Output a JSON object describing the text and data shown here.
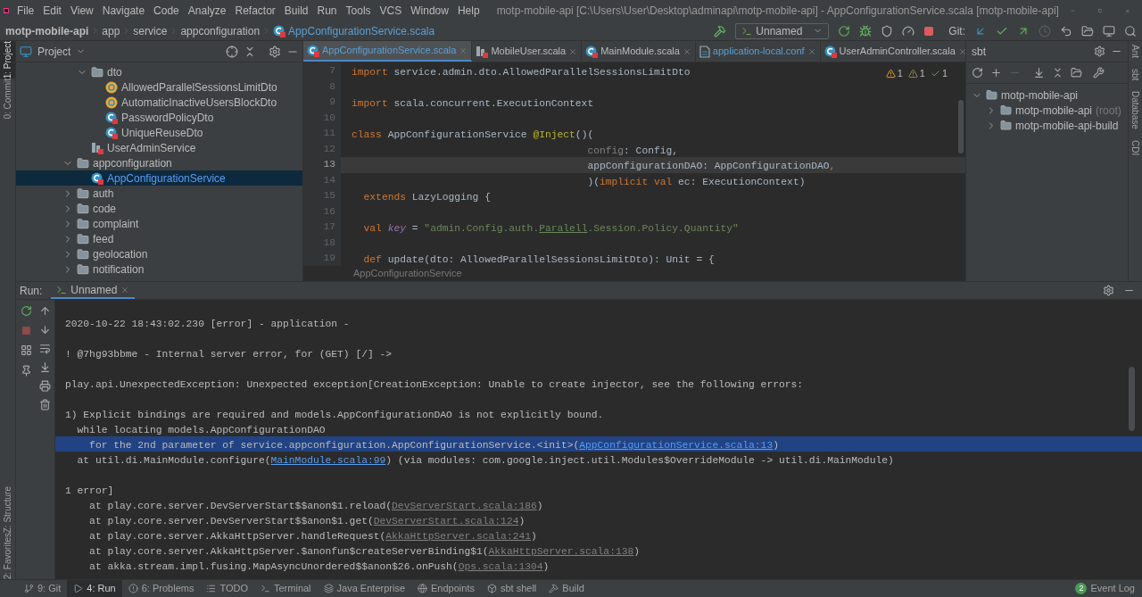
{
  "title_bar": {
    "menu": [
      "File",
      "Edit",
      "View",
      "Navigate",
      "Code",
      "Analyze",
      "Refactor",
      "Build",
      "Run",
      "Tools",
      "VCS",
      "Window",
      "Help"
    ],
    "title": "motp-mobile-api [C:\\Users\\User\\Desktop\\adminapi\\motp-mobile-api] - AppConfigurationService.scala [motp-mobile-api]"
  },
  "nav_bar": {
    "breadcrumbs": [
      {
        "label": "motp-mobile-api",
        "kind": "project"
      },
      {
        "label": "app",
        "kind": "folder"
      },
      {
        "label": "service",
        "kind": "folder"
      },
      {
        "label": "appconfiguration",
        "kind": "folder"
      },
      {
        "label": "AppConfigurationService.scala",
        "kind": "class"
      }
    ],
    "run_config": "Unnamed",
    "git_label": "Git:"
  },
  "left_strip": {
    "top": [
      {
        "label": "1: Project",
        "selected": true
      },
      {
        "label": "0: Commit",
        "selected": false
      }
    ],
    "bottom": [
      {
        "label": "Z: Structure",
        "selected": false
      },
      {
        "label": "2: Favorites",
        "selected": false
      }
    ]
  },
  "project": {
    "title": "Project",
    "partial_branch": [
      {
        "label": "dto",
        "kind": "folder",
        "expanded": true,
        "selected": false,
        "children": [
          {
            "label": "AllowedParallelSessionsLimitDto",
            "kind": "object",
            "selected": false
          },
          {
            "label": "AutomaticInactiveUsersBlockDto",
            "kind": "object",
            "selected": false
          },
          {
            "label": "PasswordPolicyDto",
            "kind": "class",
            "selected": false
          },
          {
            "label": "UniqueReuseDto",
            "kind": "class",
            "selected": false
          }
        ]
      },
      {
        "label": "UserAdminService",
        "kind": "trait",
        "selected": false
      }
    ],
    "tree": [
      {
        "label": "appconfiguration",
        "kind": "folder",
        "expanded": true,
        "selected": false,
        "children": [
          {
            "label": "AppConfigurationService",
            "kind": "class",
            "selected": true
          }
        ]
      },
      {
        "label": "auth",
        "kind": "folder",
        "expanded": false,
        "selected": false
      },
      {
        "label": "code",
        "kind": "folder",
        "expanded": false,
        "selected": false
      },
      {
        "label": "complaint",
        "kind": "folder",
        "expanded": false,
        "selected": false
      },
      {
        "label": "feed",
        "kind": "folder",
        "expanded": false,
        "selected": false
      },
      {
        "label": "geolocation",
        "kind": "folder",
        "expanded": false,
        "selected": false
      },
      {
        "label": "notification",
        "kind": "folder",
        "expanded": false,
        "selected": false
      }
    ]
  },
  "editor": {
    "tabs": [
      {
        "label": "AppConfigurationService.scala",
        "kind": "class",
        "selected": true
      },
      {
        "label": "MobileUser.scala",
        "kind": "trait",
        "selected": false
      },
      {
        "label": "MainModule.scala",
        "kind": "class",
        "selected": false
      },
      {
        "label": "application-local.conf",
        "kind": "conf",
        "selected": false
      },
      {
        "label": "UserAdminController.scala",
        "kind": "class",
        "selected": false
      }
    ],
    "inspections": [
      {
        "count": "1",
        "kind": "warning"
      },
      {
        "count": "1",
        "kind": "weak_warning"
      },
      {
        "count": "1",
        "kind": "typo"
      }
    ],
    "lines": [
      {
        "number": "7",
        "current": false,
        "kind": "top",
        "tokens": [
          {
            "text": "import",
            "kind": "keyword"
          },
          {
            "text": " service.admin.dto.AllowedParallelSessionsLimitDto",
            "kind": "plain"
          }
        ]
      },
      {
        "number": "8",
        "current": false
      },
      {
        "number": "9",
        "current": false,
        "kind": "top",
        "tokens": [
          {
            "text": "import",
            "kind": "keyword"
          },
          {
            "text": " scala.concurrent.ExecutionContext",
            "kind": "plain"
          }
        ]
      },
      {
        "number": "10",
        "current": false
      },
      {
        "number": "11",
        "current": false,
        "kind": "top",
        "tokens": [
          {
            "text": "class",
            "kind": "keyword"
          },
          {
            "text": " AppConfigurationService ",
            "kind": "plain"
          },
          {
            "text": "@Inject",
            "kind": "annotation"
          },
          {
            "text": "()(",
            "kind": "plain"
          }
        ]
      },
      {
        "number": "12",
        "current": false,
        "kind": "param",
        "tokens": [
          {
            "text": "config",
            "kind": "unused"
          },
          {
            "text": ": Config,",
            "kind": "plain"
          }
        ]
      },
      {
        "number": "13",
        "current": true,
        "kind": "param",
        "tokens": [
          {
            "text": "appConfigurationDAO: AppConfigurationDAO",
            "kind": "plain"
          },
          {
            "text": ",",
            "kind": "keyword"
          }
        ]
      },
      {
        "number": "14",
        "current": false,
        "kind": "param",
        "tokens": [
          {
            "text": ")(",
            "kind": "plain"
          },
          {
            "text": "implicit val",
            "kind": "keyword"
          },
          {
            "text": " ec: ExecutionContext)",
            "kind": "plain"
          }
        ]
      },
      {
        "number": "15",
        "current": false,
        "kind": "member",
        "tokens": [
          {
            "text": "extends",
            "kind": "keyword"
          },
          {
            "text": " LazyLogging {",
            "kind": "plain"
          }
        ]
      },
      {
        "number": "16",
        "current": false
      },
      {
        "number": "17",
        "current": false,
        "kind": "member",
        "tokens": [
          {
            "text": "val",
            "kind": "keyword"
          },
          {
            "text": " key",
            "kind": "field"
          },
          {
            "text": " = ",
            "kind": "plain"
          },
          {
            "text": "\"admin.Config.auth.",
            "kind": "string"
          },
          {
            "text": "Paralell",
            "kind": "typo"
          },
          {
            "text": ".Session.Policy.Quantity\"",
            "kind": "string"
          }
        ]
      },
      {
        "number": "18",
        "current": false
      },
      {
        "number": "19",
        "current": false,
        "kind": "member",
        "tokens": [
          {
            "text": "def",
            "kind": "keyword"
          },
          {
            "text": " update(dto: AllowedParallelSessionsLimitDto): Unit = {",
            "kind": "plain"
          }
        ]
      }
    ],
    "breadcrumb": "AppConfigurationService"
  },
  "sbt": {
    "title": "sbt",
    "tree": [
      {
        "label": "motp-mobile-api",
        "expanded": true,
        "children": [
          {
            "label": "motp-mobile-api",
            "note": "(root)",
            "expanded": false
          },
          {
            "label": "motp-mobile-api-build",
            "expanded": false
          }
        ]
      }
    ]
  },
  "right_strip": [
    {
      "label": "Ant"
    },
    {
      "label": "sbt"
    },
    {
      "label": "Database"
    },
    {
      "label": "CDI"
    }
  ],
  "run": {
    "label": "Run:",
    "tabs": [
      {
        "label": "Unnamed",
        "selected": true
      }
    ],
    "lines": [
      {
        "selected": false,
        "kind": "top_gap",
        "segments": [
          {
            "text": "2020-10-22 18:43:02.230 [error] - application -",
            "kind": "text"
          }
        ]
      },
      {
        "selected": false,
        "kind": "top_gap",
        "segments": [
          {
            "text": "! @7hg93bbme - Internal server error, for (GET) [/] ->",
            "kind": "text"
          }
        ]
      },
      {
        "selected": false,
        "kind": "top_gap",
        "segments": [
          {
            "text": "play.api.UnexpectedException: Unexpected exception[CreationException: Unable to create injector, see the following errors:",
            "kind": "text"
          }
        ]
      },
      {
        "selected": false,
        "kind": "top_gap",
        "segments": [
          {
            "text": "1) Explicit bindings are required and models.AppConfigurationDAO is not explicitly bound.",
            "kind": "text"
          }
        ]
      },
      {
        "selected": false,
        "kind": "step",
        "segments": [
          {
            "text": "while locating models.AppConfigurationDAO",
            "kind": "text"
          }
        ]
      },
      {
        "selected": true,
        "kind": "frame",
        "segments": [
          {
            "text": "for the 2nd parameter of service.appconfiguration.AppConfigurationService.<init>(",
            "kind": "text"
          },
          {
            "text": "AppConfigurationService.scala:13",
            "kind": "link"
          },
          {
            "text": ")",
            "kind": "text"
          }
        ]
      },
      {
        "selected": false,
        "kind": "step",
        "segments": [
          {
            "text": "at util.di.MainModule.configure(",
            "kind": "text"
          },
          {
            "text": "MainModule.scala:99",
            "kind": "link"
          },
          {
            "text": ") (via modules: com.google.inject.util.Modules$OverrideModule -> util.di.MainModule)",
            "kind": "text"
          }
        ]
      },
      {
        "selected": false,
        "kind": "top_gap",
        "segments": [
          {
            "text": "1 error]",
            "kind": "text"
          }
        ]
      },
      {
        "selected": false,
        "kind": "frame",
        "segments": [
          {
            "text": "at play.core.server.DevServerStart$$anon$1.reload(",
            "kind": "text"
          },
          {
            "text": "DevServerStart.scala:186",
            "kind": "library_link"
          },
          {
            "text": ")",
            "kind": "text"
          }
        ]
      },
      {
        "selected": false,
        "kind": "frame",
        "segments": [
          {
            "text": "at play.core.server.DevServerStart$$anon$1.get(",
            "kind": "text"
          },
          {
            "text": "DevServerStart.scala:124",
            "kind": "library_link"
          },
          {
            "text": ")",
            "kind": "text"
          }
        ]
      },
      {
        "selected": false,
        "kind": "frame",
        "segments": [
          {
            "text": "at play.core.server.AkkaHttpServer.handleRequest(",
            "kind": "text"
          },
          {
            "text": "AkkaHttpServer.scala:241",
            "kind": "library_link"
          },
          {
            "text": ")",
            "kind": "text"
          }
        ]
      },
      {
        "selected": false,
        "kind": "frame",
        "segments": [
          {
            "text": "at play.core.server.AkkaHttpServer.$anonfun$createServerBinding$1(",
            "kind": "text"
          },
          {
            "text": "AkkaHttpServer.scala:138",
            "kind": "library_link"
          },
          {
            "text": ")",
            "kind": "text"
          }
        ]
      },
      {
        "selected": false,
        "kind": "frame",
        "segments": [
          {
            "text": "at akka.stream.impl.fusing.MapAsyncUnordered$$anon$26.onPush(",
            "kind": "text"
          },
          {
            "text": "Ops.scala:1304",
            "kind": "library_link"
          },
          {
            "text": ")",
            "kind": "text"
          }
        ]
      }
    ]
  },
  "bottom_bar": {
    "tools": [
      {
        "label": "9: Git",
        "kind": "git",
        "selected": false
      },
      {
        "label": "4: Run",
        "kind": "run",
        "selected": true
      },
      {
        "label": "6: Problems",
        "kind": "problems",
        "selected": false
      },
      {
        "label": "TODO",
        "kind": "todo",
        "selected": false
      },
      {
        "label": "Terminal",
        "kind": "terminal",
        "selected": false
      },
      {
        "label": "Java Enterprise",
        "kind": "enterprise",
        "selected": false
      },
      {
        "label": "Endpoints",
        "kind": "endpoints",
        "selected": false
      },
      {
        "label": "sbt shell",
        "kind": "shell",
        "selected": false
      },
      {
        "label": "Build",
        "kind": "build",
        "selected": false
      }
    ],
    "event_log": {
      "label": "Event Log",
      "count": "2"
    }
  }
}
